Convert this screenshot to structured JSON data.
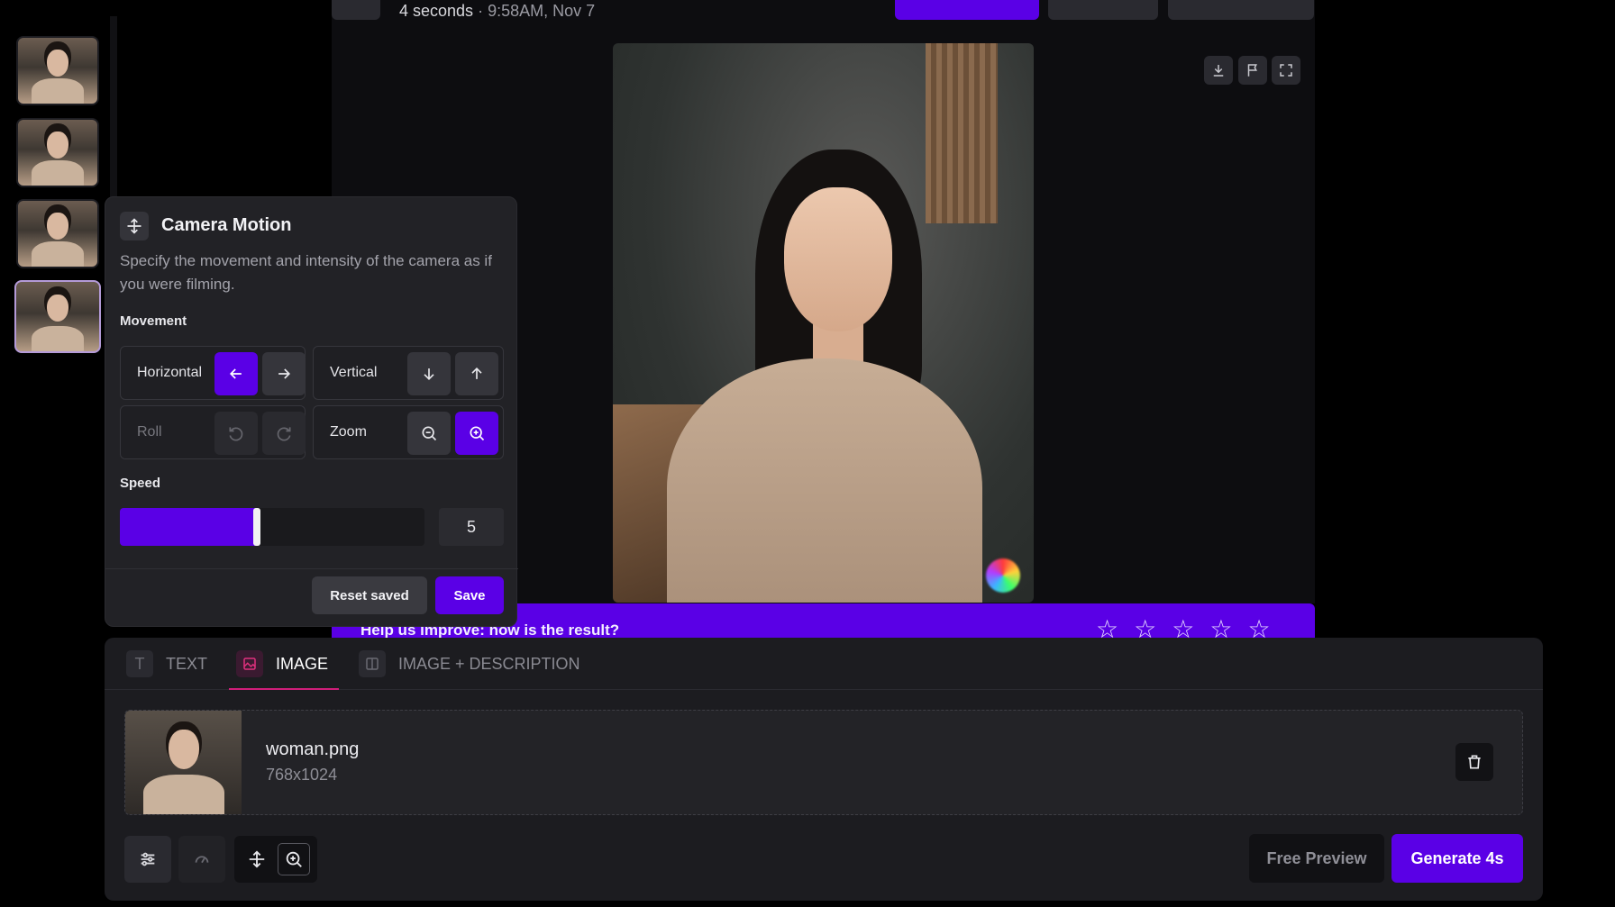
{
  "header": {
    "duration": "4 seconds",
    "separator": " · ",
    "timestamp": "9:58AM, Nov 7"
  },
  "feedback": {
    "question": "Help us improve: how is the result?",
    "stars": [
      "☆",
      "☆",
      "☆",
      "☆",
      "☆"
    ]
  },
  "camera_motion": {
    "title": "Camera Motion",
    "description": "Specify the movement and intensity of the camera as if you were filming.",
    "movement_label": "Movement",
    "horizontal": "Horizontal",
    "vertical": "Vertical",
    "roll": "Roll",
    "zoom": "Zoom",
    "speed_label": "Speed",
    "speed_value": "5",
    "speed_fraction": 0.45,
    "reset_label": "Reset saved",
    "save_label": "Save"
  },
  "composer": {
    "tabs": [
      {
        "label": "TEXT",
        "icon": "T"
      },
      {
        "label": "IMAGE",
        "icon": "image-icon"
      },
      {
        "label": "IMAGE + DESCRIPTION",
        "icon": "split-icon"
      }
    ],
    "file_name": "woman.png",
    "file_dims": "768x1024",
    "free_preview_label": "Free Preview",
    "generate_label": "Generate 4s"
  },
  "colors": {
    "accent": "#5a00e6",
    "tab_active": "#d01e7a"
  }
}
